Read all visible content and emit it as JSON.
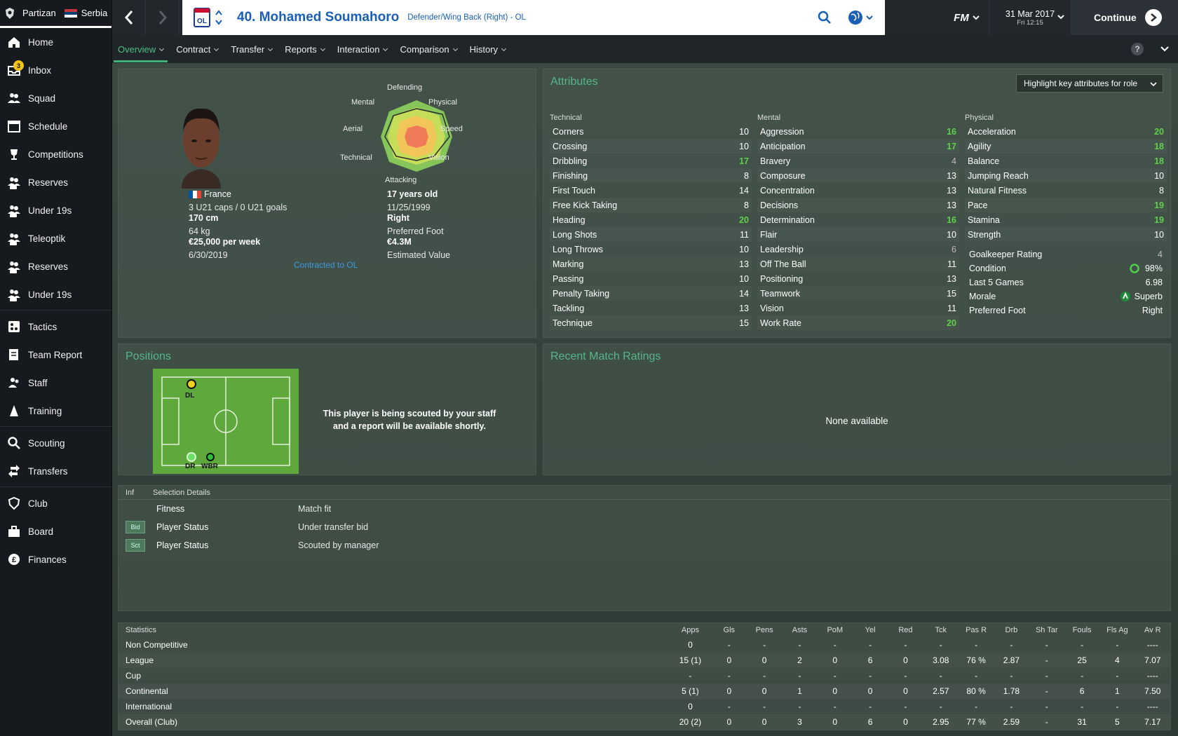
{
  "club": {
    "name": "Partizan",
    "country": "Serbia"
  },
  "nav": {
    "items": [
      {
        "label": "Home",
        "icon": "home-icon"
      },
      {
        "label": "Inbox",
        "icon": "inbox-icon",
        "badge": "3"
      },
      {
        "label": "Squad",
        "icon": "squad-icon"
      },
      {
        "label": "Schedule",
        "icon": "calendar-icon"
      },
      {
        "label": "Competitions",
        "icon": "trophy-icon"
      },
      {
        "label": "Reserves",
        "icon": "reserves-icon"
      },
      {
        "label": "Under 19s",
        "icon": "u19-icon"
      },
      {
        "label": "Teleoptik",
        "icon": "affiliate-icon"
      },
      {
        "label": "Reserves",
        "icon": "reserves-icon"
      },
      {
        "label": "Under 19s",
        "icon": "u19-icon"
      },
      {
        "label": "Tactics",
        "icon": "tactics-icon"
      },
      {
        "label": "Team Report",
        "icon": "report-icon"
      },
      {
        "label": "Staff",
        "icon": "staff-icon"
      },
      {
        "label": "Training",
        "icon": "training-icon"
      },
      {
        "label": "Scouting",
        "icon": "search-icon"
      },
      {
        "label": "Transfers",
        "icon": "transfers-icon"
      },
      {
        "label": "Club",
        "icon": "club-icon"
      },
      {
        "label": "Board",
        "icon": "board-icon"
      },
      {
        "label": "Finances",
        "icon": "finances-icon"
      }
    ]
  },
  "header": {
    "player_title": "40. Mohamed Soumahoro",
    "position": "Defender/Wing Back (Right) - OL",
    "fm_label": "FM",
    "date": "31 Mar 2017",
    "time": "Fri 12:15",
    "continue_label": "Continue"
  },
  "tabs": [
    "Overview",
    "Contract",
    "Transfer",
    "Reports",
    "Interaction",
    "Comparison",
    "History"
  ],
  "profile": {
    "nationality": "France",
    "caps": "3 U21 caps / 0 U21 goals",
    "height": "170 cm",
    "weight": "64 kg",
    "wage": "€25,000 per week",
    "contract_end": "6/30/2019",
    "age": "17 years old",
    "dob": "11/25/1999",
    "foot": "Right",
    "foot_label": "Preferred Foot",
    "value": "€4.3M",
    "value_label": "Estimated Value",
    "contracted": "Contracted to OL",
    "radar_labels": {
      "top": "Defending",
      "tr": "Physical",
      "r": "Speed",
      "br": "Vision",
      "bottom": "Attacking",
      "bl": "Technical",
      "l": "Aerial",
      "tl": "Mental"
    }
  },
  "attributes": {
    "title": "Attributes",
    "highlight_btn": "Highlight key attributes for role",
    "technical_head": "Technical",
    "mental_head": "Mental",
    "physical_head": "Physical",
    "technical": [
      {
        "name": "Corners",
        "value": "10"
      },
      {
        "name": "Crossing",
        "value": "10"
      },
      {
        "name": "Dribbling",
        "value": "17"
      },
      {
        "name": "Finishing",
        "value": "8"
      },
      {
        "name": "First Touch",
        "value": "14"
      },
      {
        "name": "Free Kick Taking",
        "value": "8"
      },
      {
        "name": "Heading",
        "value": "20"
      },
      {
        "name": "Long Shots",
        "value": "11"
      },
      {
        "name": "Long Throws",
        "value": "10"
      },
      {
        "name": "Marking",
        "value": "13"
      },
      {
        "name": "Passing",
        "value": "10"
      },
      {
        "name": "Penalty Taking",
        "value": "14"
      },
      {
        "name": "Tackling",
        "value": "13"
      },
      {
        "name": "Technique",
        "value": "15"
      }
    ],
    "mental": [
      {
        "name": "Aggression",
        "value": "16"
      },
      {
        "name": "Anticipation",
        "value": "17"
      },
      {
        "name": "Bravery",
        "value": "4"
      },
      {
        "name": "Composure",
        "value": "13"
      },
      {
        "name": "Concentration",
        "value": "13"
      },
      {
        "name": "Decisions",
        "value": "13"
      },
      {
        "name": "Determination",
        "value": "16"
      },
      {
        "name": "Flair",
        "value": "10"
      },
      {
        "name": "Leadership",
        "value": "6"
      },
      {
        "name": "Off The Ball",
        "value": "11"
      },
      {
        "name": "Positioning",
        "value": "13"
      },
      {
        "name": "Teamwork",
        "value": "15"
      },
      {
        "name": "Vision",
        "value": "11"
      },
      {
        "name": "Work Rate",
        "value": "20"
      }
    ],
    "physical": [
      {
        "name": "Acceleration",
        "value": "20"
      },
      {
        "name": "Agility",
        "value": "18"
      },
      {
        "name": "Balance",
        "value": "18"
      },
      {
        "name": "Jumping Reach",
        "value": "10"
      },
      {
        "name": "Natural Fitness",
        "value": "8"
      },
      {
        "name": "Pace",
        "value": "19"
      },
      {
        "name": "Stamina",
        "value": "19"
      },
      {
        "name": "Strength",
        "value": "10"
      }
    ],
    "misc": [
      {
        "name": "Goalkeeper Rating",
        "value": "4"
      },
      {
        "name": "Condition",
        "value": "98%"
      },
      {
        "name": "Last 5 Games",
        "value": "6.98"
      },
      {
        "name": "Morale",
        "value": "Superb"
      },
      {
        "name": "Preferred Foot",
        "value": "Right"
      }
    ]
  },
  "positions": {
    "title": "Positions",
    "labels": [
      "DL",
      "DR",
      "WBR"
    ],
    "scout_msg_1": "This player is being scouted by your staff",
    "scout_msg_2": "and a report will be available shortly."
  },
  "ratings": {
    "title": "Recent Match Ratings",
    "empty": "None available"
  },
  "selection": {
    "inf_head": "Inf",
    "details_head": "Selection Details",
    "rows": [
      {
        "tag": "",
        "label": "Fitness",
        "value": "Match fit"
      },
      {
        "tag": "Bid",
        "label": "Player Status",
        "value": "Under transfer bid"
      },
      {
        "tag": "Sct",
        "label": "Player Status",
        "value": "Scouted by manager"
      }
    ]
  },
  "statistics": {
    "headers": [
      "Statistics",
      "Apps",
      "Gls",
      "Pens",
      "Asts",
      "PoM",
      "Yel",
      "Red",
      "Tck",
      "Pas R",
      "Drb",
      "Sh Tar",
      "Fouls",
      "Fls Ag",
      "Av R"
    ],
    "rows": [
      [
        "Non Competitive",
        "0",
        "-",
        "-",
        "-",
        "-",
        "-",
        "-",
        "-",
        "-",
        "-",
        "-",
        "-",
        "-",
        "----"
      ],
      [
        "League",
        "15 (1)",
        "0",
        "0",
        "2",
        "0",
        "6",
        "0",
        "3.08",
        "76 %",
        "2.87",
        "-",
        "25",
        "4",
        "7.07"
      ],
      [
        "Cup",
        "-",
        "-",
        "-",
        "-",
        "-",
        "-",
        "-",
        "-",
        "-",
        "-",
        "-",
        "-",
        "-",
        "----"
      ],
      [
        "Continental",
        "5 (1)",
        "0",
        "0",
        "1",
        "0",
        "0",
        "0",
        "2.57",
        "80 %",
        "1.78",
        "-",
        "6",
        "1",
        "7.50"
      ],
      [
        "International",
        "0",
        "-",
        "-",
        "-",
        "-",
        "-",
        "-",
        "-",
        "-",
        "-",
        "-",
        "-",
        "-",
        "----"
      ],
      [
        "Overall (Club)",
        "20 (2)",
        "0",
        "0",
        "3",
        "0",
        "6",
        "0",
        "2.95",
        "77 %",
        "2.59",
        "-",
        "31",
        "5",
        "7.17"
      ]
    ]
  }
}
